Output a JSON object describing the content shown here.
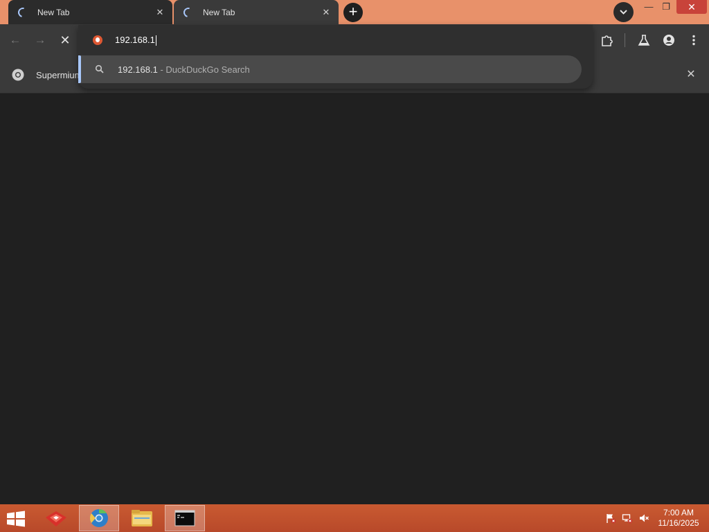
{
  "browser": {
    "tabs": [
      {
        "title": "New Tab",
        "loading": true,
        "active": false
      },
      {
        "title": "New Tab",
        "loading": true,
        "active": true
      }
    ],
    "new_tab_symbol": "+",
    "tab_close_symbol": "✕",
    "window_controls": {
      "minimize": "—",
      "maximize": "❐",
      "close": "✕"
    },
    "nav": {
      "back": "←",
      "forward": "→",
      "stop": "✕"
    },
    "omnibox": {
      "value": "192.168.1",
      "suggestion": {
        "query": "192.168.1",
        "separator": " - ",
        "provider": "DuckDuckGo Search"
      }
    },
    "bookmarks_bar": {
      "label": "Supermium",
      "close_symbol": "✕"
    },
    "icons": [
      "loading-spinner-icon",
      "tab-search-icon",
      "duckduckgo-icon",
      "search-icon",
      "extensions-icon",
      "labs-flask-icon",
      "profile-icon",
      "menu-dots-icon",
      "chrome-icon"
    ]
  },
  "taskbar": {
    "clock_time": "7:00 AM",
    "clock_date": "11/16/2025",
    "items": [
      "start-icon",
      "app-icon",
      "browser-icon",
      "file-explorer-icon",
      "command-prompt-icon"
    ],
    "tray": [
      "action-center-flag-icon",
      "network-icon",
      "volume-muted-icon"
    ],
    "colors": {
      "taskbar": "#c95a31",
      "titlebar": "#e8916a",
      "accent": "#a8c7fa"
    }
  }
}
